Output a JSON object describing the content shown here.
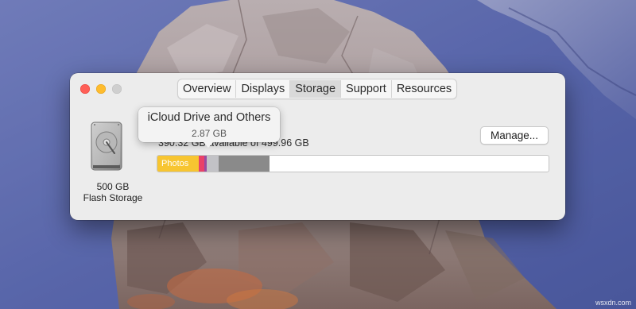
{
  "window": {
    "tabs": [
      {
        "label": "Overview",
        "active": false
      },
      {
        "label": "Displays",
        "active": false
      },
      {
        "label": "Storage",
        "active": true
      },
      {
        "label": "Support",
        "active": false
      },
      {
        "label": "Resources",
        "active": false
      }
    ]
  },
  "storage": {
    "disk_icon": "hard-drive-icon",
    "capacity_label": "500 GB",
    "type_label": "Flash Storage",
    "available_text": "390.32 GB available of 499.96 GB",
    "manage_label": "Manage...",
    "bar": {
      "segments": [
        {
          "name": "photos",
          "label": "Photos",
          "fraction": 0.105,
          "color": "#f7c531"
        },
        {
          "name": "other-a",
          "label": "",
          "fraction": 0.014,
          "color": "#e94168"
        },
        {
          "name": "icloud",
          "label": "",
          "fraction": 0.008,
          "color": "#9a4aa0"
        },
        {
          "name": "system-a",
          "label": "",
          "fraction": 0.03,
          "color": "#c2c2c6"
        },
        {
          "name": "system-b",
          "label": "",
          "fraction": 0.13,
          "color": "#8a8a8a"
        }
      ]
    },
    "tooltip": {
      "title": "iCloud Drive and Others",
      "value": "2.87 GB"
    }
  },
  "desktop": {
    "watermark": "wsxdn.com"
  },
  "colors": {
    "close": "#ff5f57",
    "minimize": "#febc2e",
    "zoom": "#cfcfcf",
    "photos": "#f7c531"
  }
}
